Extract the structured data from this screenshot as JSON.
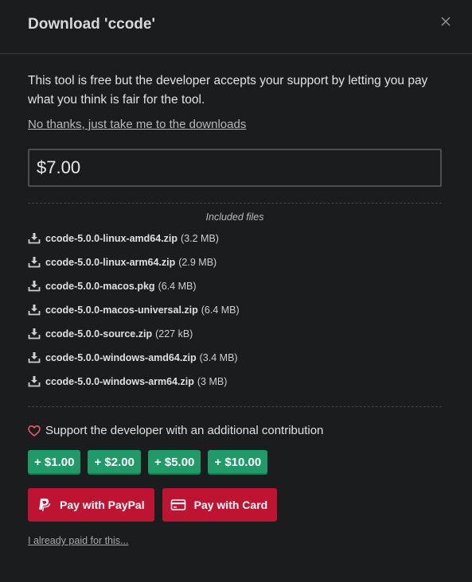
{
  "dialog": {
    "title": "Download 'ccode'",
    "close_icon": "close-icon"
  },
  "intro_text": "This tool is free but the developer accepts your support by letting you pay what you think is fair for the tool.",
  "no_thanks_link": "No thanks, just take me to the downloads",
  "price_input": {
    "value": "$7.00"
  },
  "files": {
    "heading": "Included files",
    "icon": "download-icon",
    "items": [
      {
        "name": "ccode-5.0.0-linux-amd64.zip",
        "size": "(3.2 MB)"
      },
      {
        "name": "ccode-5.0.0-linux-arm64.zip",
        "size": "(2.9 MB)"
      },
      {
        "name": "ccode-5.0.0-macos.pkg",
        "size": "(6.4 MB)"
      },
      {
        "name": "ccode-5.0.0-macos-universal.zip",
        "size": "(6.4 MB)"
      },
      {
        "name": "ccode-5.0.0-source.zip",
        "size": "(227 kB)"
      },
      {
        "name": "ccode-5.0.0-windows-amd64.zip",
        "size": "(3.4 MB)"
      },
      {
        "name": "ccode-5.0.0-windows-arm64.zip",
        "size": "(3 MB)"
      }
    ]
  },
  "support": {
    "icon": "heart-icon",
    "text": "Support the developer with an additional contribution",
    "amounts": [
      "+ $1.00",
      "+ $2.00",
      "+ $5.00",
      "+ $10.00"
    ]
  },
  "payment": {
    "paypal_label": "Pay with PayPal",
    "card_label": "Pay with Card"
  },
  "already_paid_link": "I already paid for this...",
  "colors": {
    "background": "#1b1c1d",
    "accent_green": "#1f9a68",
    "accent_red": "#be1331",
    "heart": "#e8576a"
  }
}
